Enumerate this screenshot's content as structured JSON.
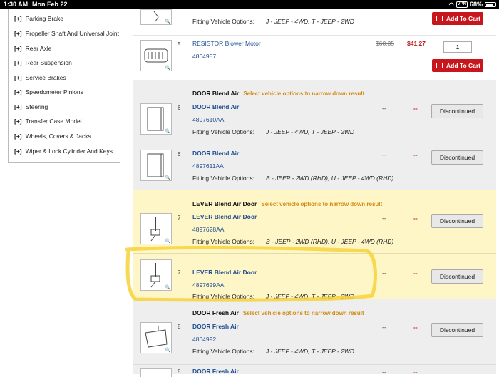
{
  "status_bar": {
    "time": "1:30 AM",
    "date": "Mon Feb 22",
    "vpn": "VPN",
    "battery": "68%"
  },
  "sidebar": {
    "plus": "[+]",
    "items": [
      "Parking Brake",
      "Propeller Shaft And Universal Joint",
      "Rear Axle",
      "Rear Suspension",
      "Service Brakes",
      "Speedometer Pinions",
      "Steering",
      "Transfer Case Model",
      "Wheels, Covers & Jacks",
      "Wiper & Lock Cylinder And Keys"
    ]
  },
  "labels": {
    "fitting": "Fitting Vehicle Options:",
    "add_to_cart": "Add To Cart",
    "discontinued": "Discontinued",
    "select_options": "Select vehicle options to narrow down result",
    "dash": "--"
  },
  "top_row": {
    "fitting_values": "J - JEEP - 4WD, T - JEEP - 2WD"
  },
  "resistor": {
    "ref": "5",
    "name": "RESISTOR Blower Motor",
    "part": "4864957",
    "msrp": "$60.35",
    "price": "$41.27",
    "qty": "1"
  },
  "groups": {
    "door_blend": "DOOR Blend Air",
    "lever_blend": "LEVER Blend Air Door",
    "door_fresh": "DOOR Fresh Air"
  },
  "parts": [
    {
      "ref": "6",
      "name": "DOOR Blend Air",
      "part": "4897610AA",
      "fit": "J - JEEP - 4WD, T - JEEP - 2WD"
    },
    {
      "ref": "6",
      "name": "DOOR Blend Air",
      "part": "4897611AA",
      "fit": "B - JEEP - 2WD (RHD), U - JEEP - 4WD (RHD)"
    },
    {
      "ref": "7",
      "name": "LEVER Blend Air Door",
      "part": "4897628AA",
      "fit": "B - JEEP - 2WD (RHD), U - JEEP - 4WD (RHD)"
    },
    {
      "ref": "7",
      "name": "LEVER Blend Air Door",
      "part": "4897629AA",
      "fit": "J - JEEP - 4WD, T - JEEP - 2WD"
    },
    {
      "ref": "8",
      "name": "DOOR Fresh Air",
      "part": "4864992",
      "fit": "J - JEEP - 4WD, T - JEEP - 2WD"
    },
    {
      "ref": "8",
      "name": "DOOR Fresh Air"
    }
  ],
  "colors": {
    "highlight_bg": "#fff6c8",
    "gray_bg": "#eeeeee",
    "marker": "#f7d23a",
    "link": "#1f4f93",
    "cart_red": "#c9161d",
    "notice_orange": "#d28a12"
  }
}
